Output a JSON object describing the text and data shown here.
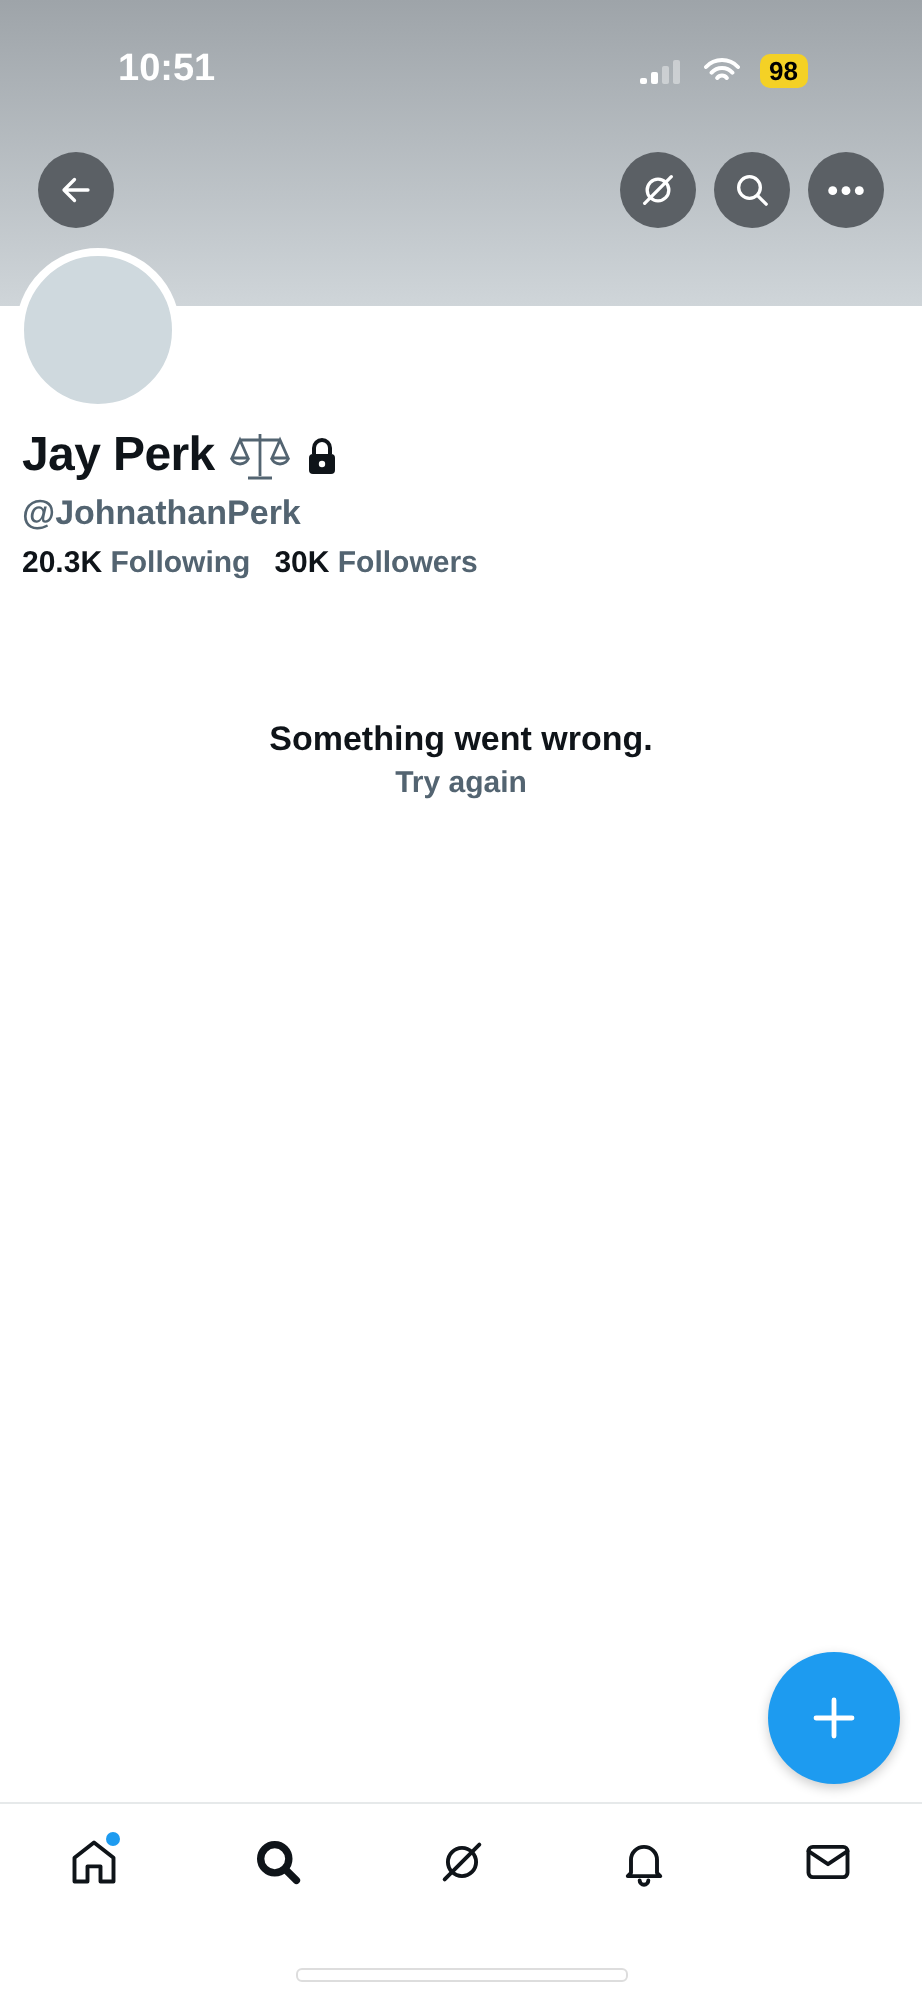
{
  "status_bar": {
    "time": "10:51",
    "battery": "98"
  },
  "header": {
    "actions": [
      {
        "kind": "grok"
      },
      {
        "kind": "search"
      },
      {
        "kind": "more"
      }
    ]
  },
  "profile": {
    "name": "Jay Perk",
    "handle": "@JohnathanPerk",
    "protected": true,
    "following_count": "20.3K",
    "following_label": "Following",
    "followers_count": "30K",
    "followers_label": "Followers"
  },
  "error": {
    "message": "Something went wrong.",
    "retry": "Try again"
  },
  "tab_bar": [
    {
      "kind": "home",
      "unread": true
    },
    {
      "kind": "search",
      "unread": false
    },
    {
      "kind": "grok",
      "unread": false
    },
    {
      "kind": "notifications",
      "unread": false
    },
    {
      "kind": "messages",
      "unread": false
    }
  ]
}
